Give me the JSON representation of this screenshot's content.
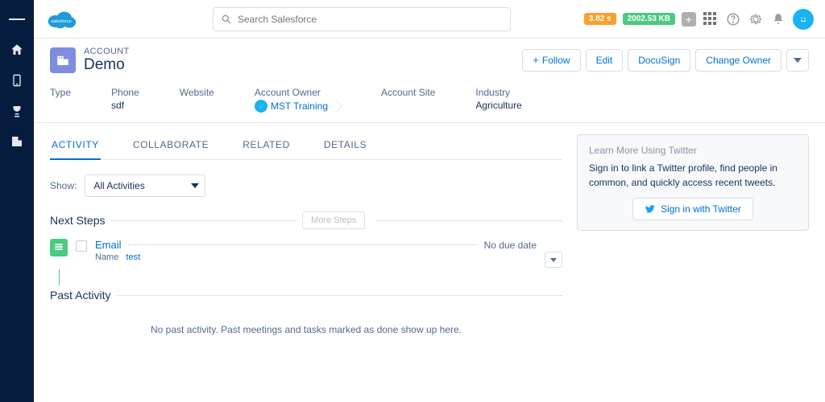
{
  "brand": {
    "name": "salesforce"
  },
  "search": {
    "placeholder": "Search Salesforce"
  },
  "perf": {
    "time": "3.82 s",
    "size": "2002.53 KB"
  },
  "record": {
    "type_label": "ACCOUNT",
    "name": "Demo",
    "actions": {
      "follow": "Follow",
      "edit": "Edit",
      "docusign": "DocuSign",
      "change_owner": "Change Owner"
    }
  },
  "fields": {
    "type": {
      "label": "Type",
      "value": ""
    },
    "phone": {
      "label": "Phone",
      "value": "sdf"
    },
    "website": {
      "label": "Website",
      "value": ""
    },
    "owner": {
      "label": "Account Owner",
      "value": "MST Training"
    },
    "site": {
      "label": "Account Site",
      "value": ""
    },
    "industry": {
      "label": "Industry",
      "value": "Agriculture"
    }
  },
  "tabs": {
    "activity": "ACTIVITY",
    "collaborate": "COLLABORATE",
    "related": "RELATED",
    "details": "DETAILS"
  },
  "activity": {
    "show_label": "Show:",
    "filter": "All Activities",
    "next_steps": "Next Steps",
    "more_steps": "More Steps",
    "task": {
      "title": "Email",
      "name_label": "Name",
      "name_value": "test",
      "due": "No due date"
    },
    "past_activity": "Past Activity",
    "past_empty": "No past activity. Past meetings and tasks marked as done show up here."
  },
  "twitter": {
    "title": "Learn More Using Twitter",
    "desc": "Sign in to link a Twitter profile, find people in common, and quickly access recent tweets.",
    "button": "Sign in with Twitter"
  }
}
